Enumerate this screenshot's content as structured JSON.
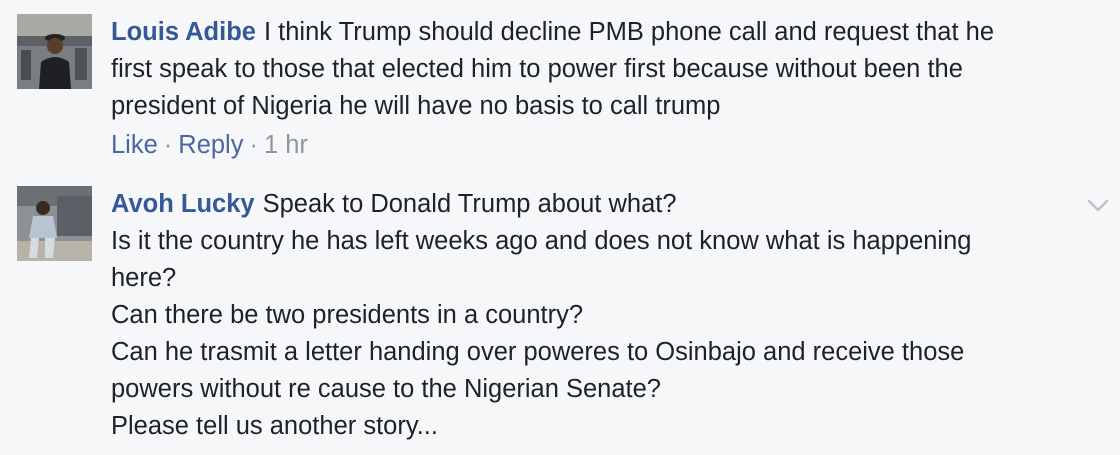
{
  "comments": [
    {
      "author": "Louis Adibe",
      "lines": [
        "I think Trump should decline PMB phone call and request that he",
        "first speak to those that elected him to power first because without been the",
        "president of Nigeria he will have no basis to call trump"
      ],
      "like_label": "Like",
      "reply_label": "Reply",
      "time": "1 hr"
    },
    {
      "author": "Avoh Lucky",
      "lines": [
        "Speak to Donald Trump about what?",
        "Is it the country he has left weeks ago and does not know what is happening",
        "here?",
        "Can there be two presidents in a country?",
        "Can he trasmit a letter handing over poweres to Osinbajo and receive those",
        "powers without re cause to the Nigerian Senate?",
        "Please tell us another story..."
      ]
    }
  ],
  "separator": "·",
  "icons": {
    "options": "chevron-down-icon"
  },
  "colors": {
    "author": "#365899",
    "link": "#4b67a1",
    "meta": "#90949c",
    "background": "#f6f7f9"
  }
}
